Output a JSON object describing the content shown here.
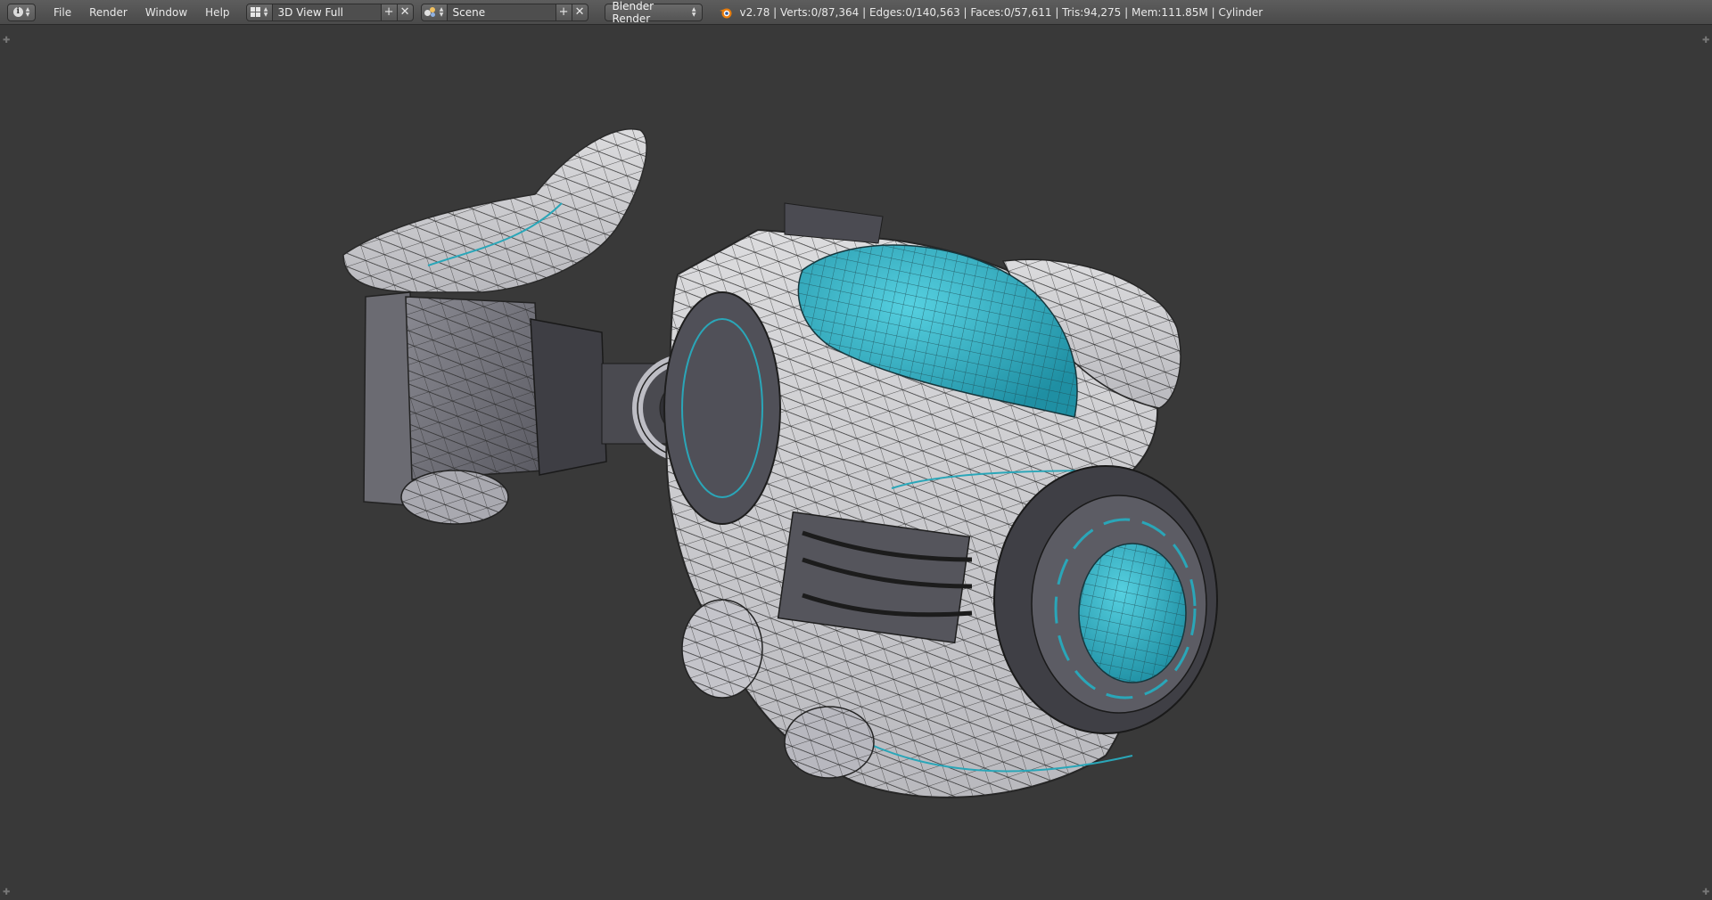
{
  "header": {
    "editor_type_icon": "info-icon",
    "menu": [
      "File",
      "Render",
      "Window",
      "Help"
    ],
    "screen_layout": {
      "icon": "screen-layout-icon",
      "value": "3D View Full",
      "add_icon": "plus-icon",
      "remove_icon": "close-icon"
    },
    "scene": {
      "icon": "scene-icon",
      "value": "Scene",
      "add_icon": "plus-icon",
      "remove_icon": "close-icon"
    },
    "render_engine": "Blender Render",
    "app_icon": "blender-logo-icon",
    "stats": "v2.78 | Verts:0/87,364 | Edges:0/140,563 | Faces:0/57,611 | Tris:94,275 | Mem:111.85M | Cylinder"
  },
  "viewport": {
    "editor": "3D View",
    "background_color": "#393939",
    "accent_color": "#2aa6b8",
    "object_description": "wireframe-shaded sci-fi camera/drone model"
  }
}
